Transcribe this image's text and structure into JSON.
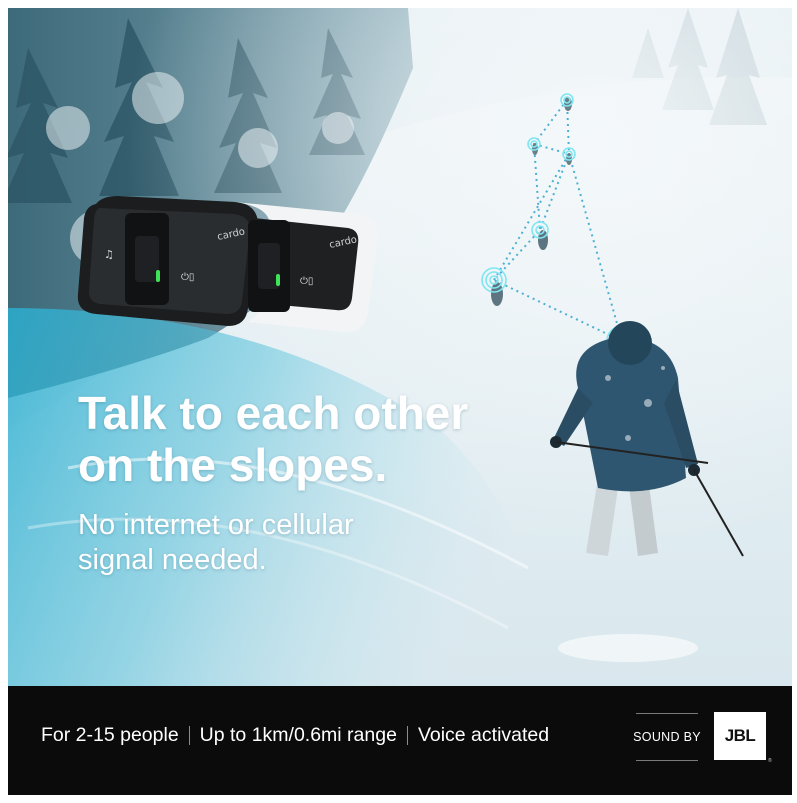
{
  "hero": {
    "headline_line1": "Talk to each other",
    "headline_line2": "on the slopes.",
    "subhead_line1": "No internet or cellular",
    "subhead_line2": "signal needed."
  },
  "device": {
    "brand": "cardo"
  },
  "footer": {
    "features": [
      "For 2-15 people",
      "Up to 1km/0.6mi range",
      "Voice activated"
    ],
    "sound_by": "SOUND BY",
    "partner_logo": "JBL"
  },
  "colors": {
    "accent": "#3aa9cf",
    "footer_bg": "#0b0b0b",
    "led_green": "#3ee35a",
    "signal_cyan": "#7fe6f2"
  }
}
